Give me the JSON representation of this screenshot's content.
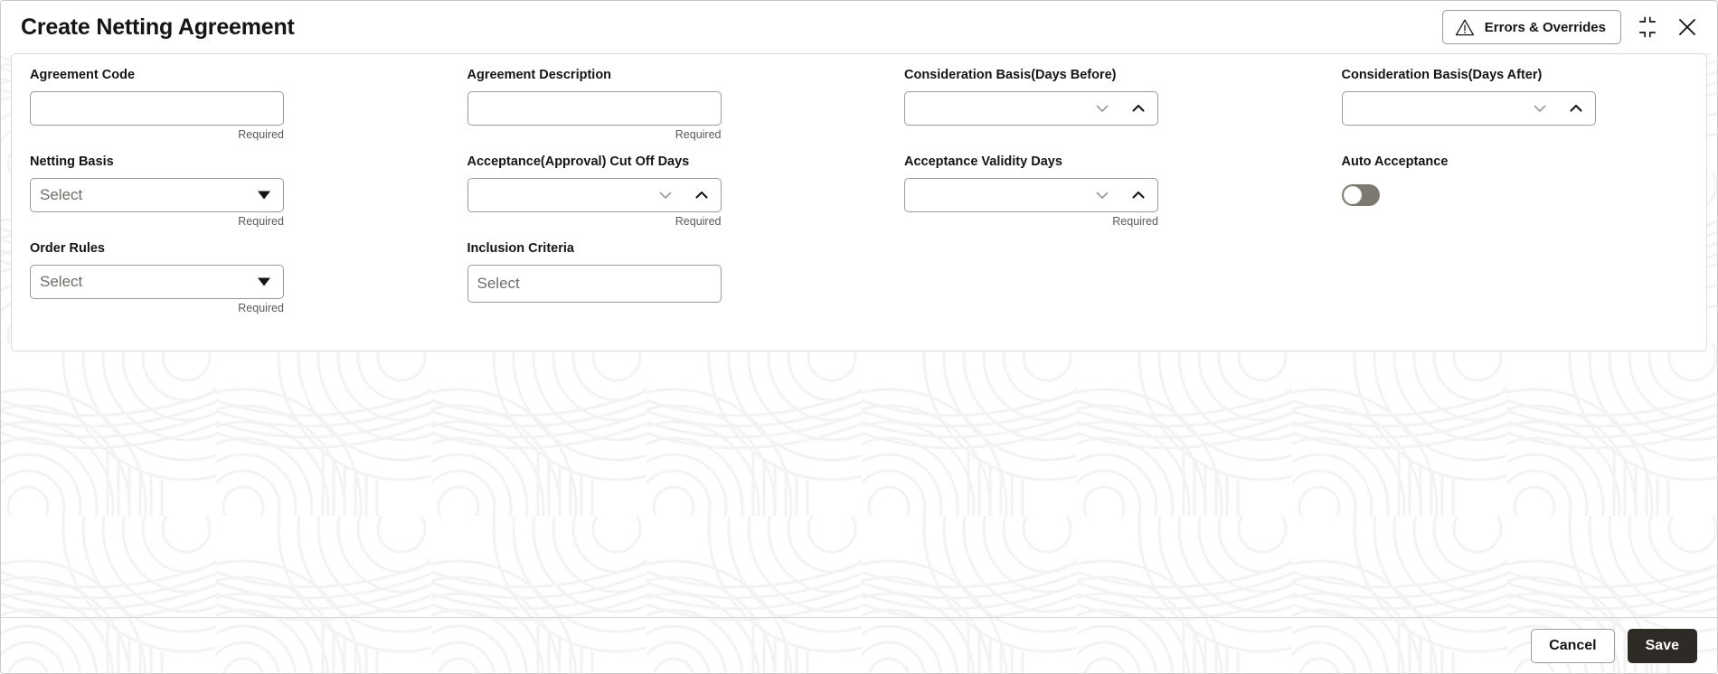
{
  "window": {
    "title": "Create Netting Agreement",
    "errors_button_label": "Errors & Overrides",
    "errors_icon": "warning-triangle-icon",
    "minimize_icon": "collapse-corners-icon",
    "close_icon": "close-x-icon"
  },
  "colors": {
    "accent_dark": "#2e2a25",
    "border": "#9c9a96",
    "panel_border": "#dcdcdc",
    "text": "#161513",
    "placeholder": "#6f6d68",
    "hint": "#5c5a56",
    "toggle_off_track": "#7d7971",
    "toggle_knob": "#ffffff",
    "spin_down_arrow": "#9c9a96",
    "spin_up_arrow": "#161513",
    "watermark": "#f4f4f4"
  },
  "form": {
    "fields": [
      {
        "id": "agreement-code",
        "label": "Agreement Code",
        "type": "text",
        "value": "",
        "placeholder": "",
        "hint": "Required"
      },
      {
        "id": "agreement-description",
        "label": "Agreement Description",
        "type": "text",
        "value": "",
        "placeholder": "",
        "hint": "Required"
      },
      {
        "id": "consideration-basis-days-before",
        "label": "Consideration Basis(Days Before)",
        "type": "spinner",
        "value": "",
        "placeholder": "",
        "hint": ""
      },
      {
        "id": "consideration-basis-days-after",
        "label": "Consideration Basis(Days After)",
        "type": "spinner",
        "value": "",
        "placeholder": "",
        "hint": ""
      },
      {
        "id": "netting-basis",
        "label": "Netting Basis",
        "type": "select",
        "value": "",
        "placeholder": "Select",
        "hint": "Required"
      },
      {
        "id": "acceptance-approval-cut-off-days",
        "label": "Acceptance(Approval) Cut Off Days",
        "type": "spinner",
        "value": "",
        "placeholder": "",
        "hint": "Required"
      },
      {
        "id": "acceptance-validity-days",
        "label": "Acceptance Validity Days",
        "type": "spinner",
        "value": "",
        "placeholder": "",
        "hint": "Required"
      },
      {
        "id": "auto-acceptance",
        "label": "Auto Acceptance",
        "type": "toggle",
        "value": "off",
        "placeholder": "",
        "hint": ""
      },
      {
        "id": "order-rules",
        "label": "Order Rules",
        "type": "select",
        "value": "",
        "placeholder": "Select",
        "hint": "Required"
      },
      {
        "id": "inclusion-criteria",
        "label": "Inclusion Criteria",
        "type": "lov",
        "value": "",
        "placeholder": "Select",
        "hint": ""
      }
    ]
  },
  "footer": {
    "cancel_label": "Cancel",
    "save_label": "Save"
  }
}
